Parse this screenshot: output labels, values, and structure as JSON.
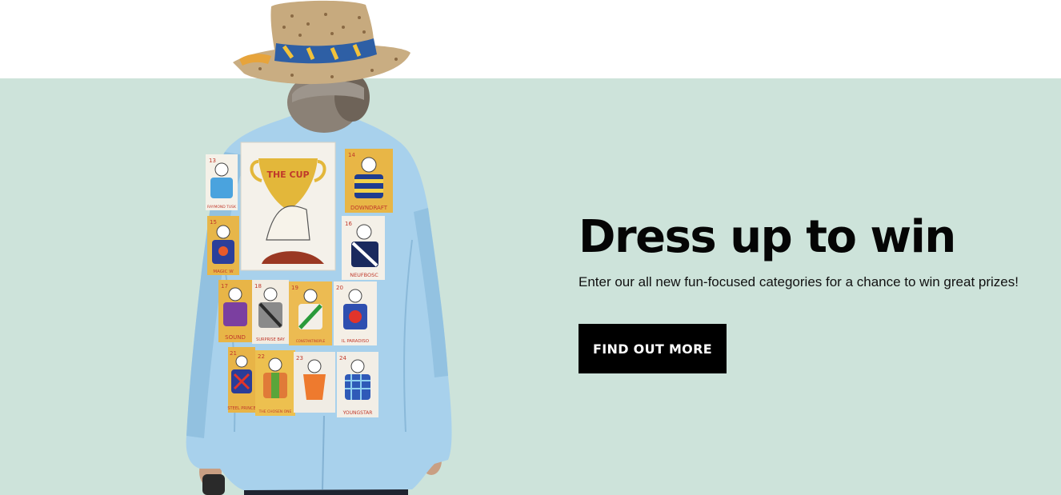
{
  "hero": {
    "title": "Dress up to win",
    "subtitle": "Enter our all new fun-focused categories for a chance to win great prizes!",
    "cta_label": "FIND OUT MORE",
    "background_color": "#cde3da",
    "image": {
      "subject": "person-in-jacket-with-jockey-drawings",
      "patches": {
        "cup": "THE CUP",
        "row1": [
          {
            "number": "13",
            "name": "RAYMOND TUSK"
          },
          {
            "number": "14",
            "name": "DOWNDRAFT"
          }
        ],
        "row2": [
          {
            "number": "15",
            "name": "MAGIC W"
          },
          {
            "number": "16",
            "name": "NEUFBOSC"
          }
        ],
        "row3": [
          {
            "number": "17",
            "name": "SOUND"
          },
          {
            "number": "18",
            "name": "SURPRISE BAY"
          },
          {
            "number": "19",
            "name": "CONSTANTINOPLE"
          },
          {
            "number": "20",
            "name": "IL PARADISO"
          }
        ],
        "row4": [
          {
            "number": "21",
            "name": "STEEL PRINCE"
          },
          {
            "number": "22",
            "name": "THE CHOSEN ONE"
          },
          {
            "number": "23",
            "name": ""
          },
          {
            "number": "24",
            "name": "YOUNGSTAR"
          }
        ]
      }
    }
  }
}
